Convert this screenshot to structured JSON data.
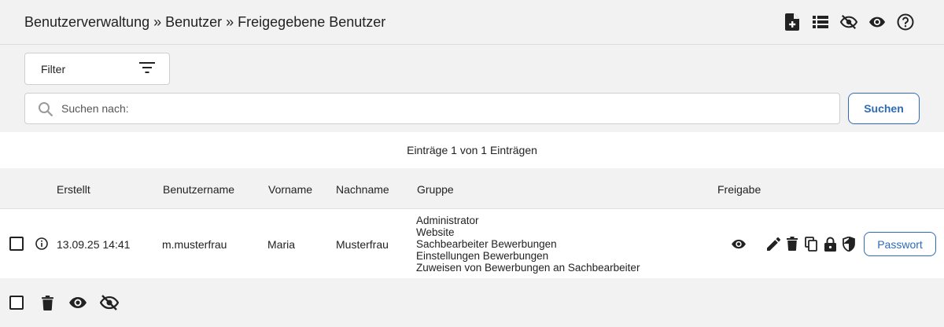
{
  "header": {
    "breadcrumb": "Benutzerverwaltung » Benutzer » Freigegebene Benutzer",
    "icons": [
      "new-document-icon",
      "list-icon",
      "hidden-icon",
      "visible-icon",
      "help-icon"
    ]
  },
  "filter": {
    "label": "Filter"
  },
  "search": {
    "placeholder": "Suchen nach:",
    "value": "",
    "button_label": "Suchen"
  },
  "entries_info": "Einträge 1 von 1 Einträgen",
  "table": {
    "columns": {
      "created": "Erstellt",
      "username": "Benutzername",
      "firstname": "Vorname",
      "lastname": "Nachname",
      "group": "Gruppe",
      "release": "Freigabe"
    },
    "rows": [
      {
        "created": "13.09.25 14:41",
        "username": "m.musterfrau",
        "firstname": "Maria",
        "lastname": "Musterfrau",
        "groups": [
          "Administrator",
          "Website",
          "Sachbearbeiter Bewerbungen",
          "Einstellungen Bewerbungen",
          "Zuweisen von Bewerbungen an Sachbearbeiter"
        ],
        "password_label": "Passwort"
      }
    ]
  },
  "colors": {
    "accent": "#2d6ab8",
    "background": "#f2f2f2",
    "text": "#222222"
  }
}
